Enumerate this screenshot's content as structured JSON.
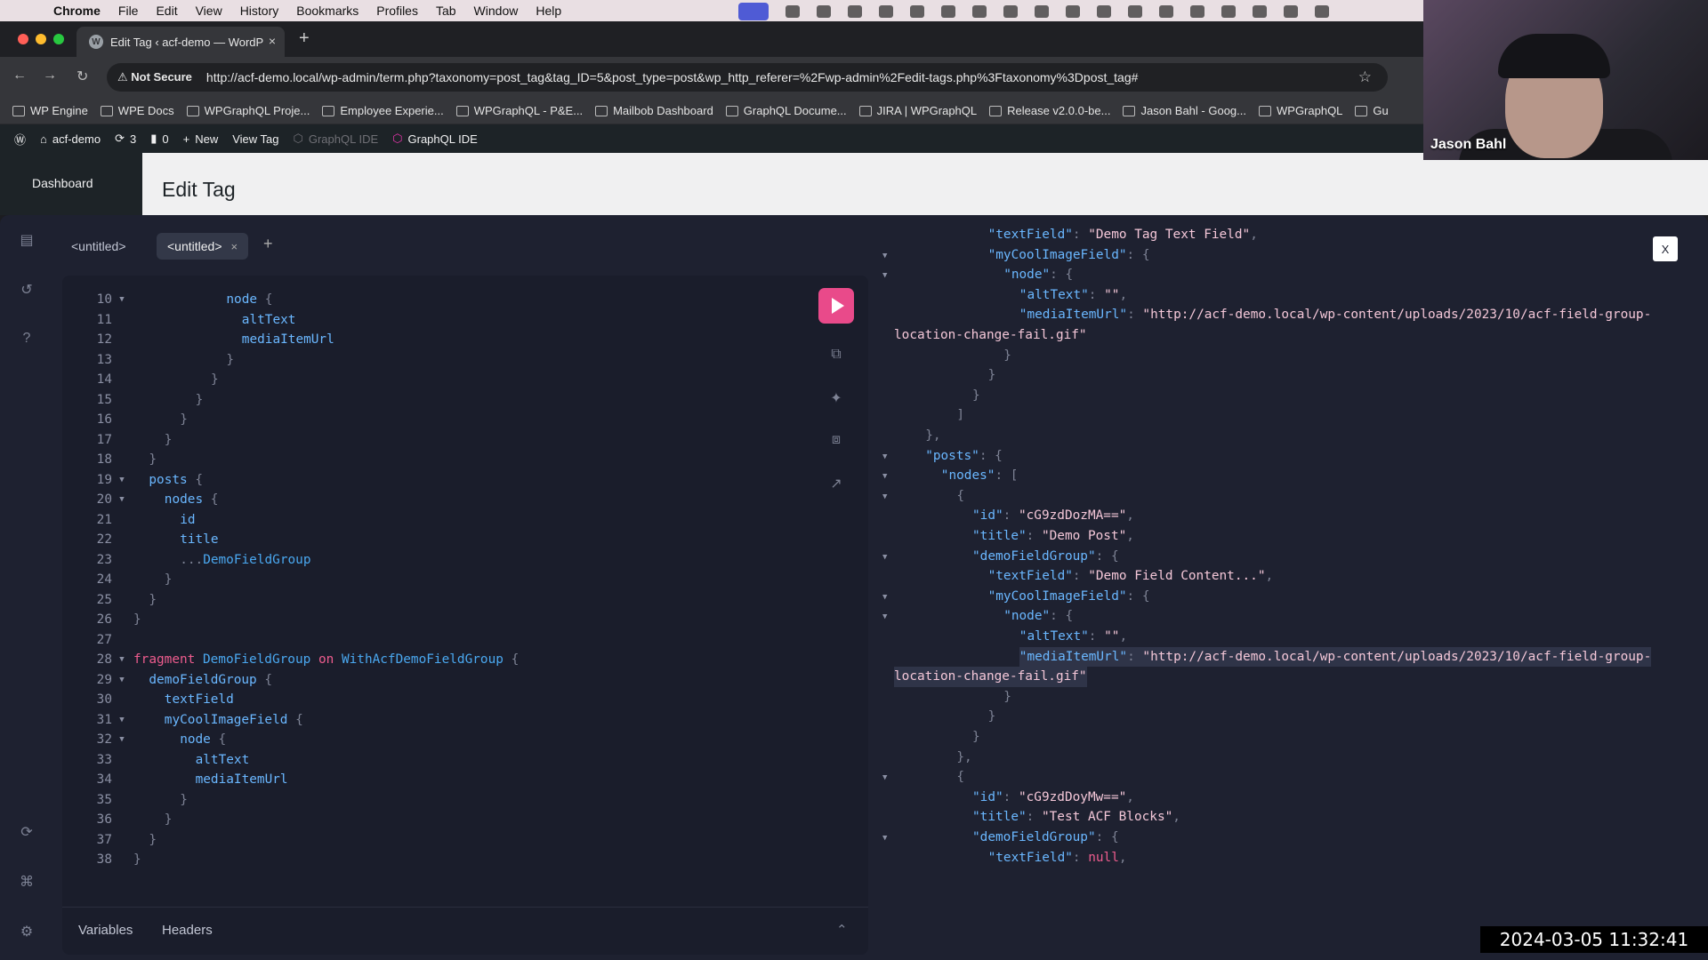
{
  "menubar": {
    "items": [
      "Chrome",
      "File",
      "Edit",
      "View",
      "History",
      "Bookmarks",
      "Profiles",
      "Tab",
      "Window",
      "Help"
    ]
  },
  "browser": {
    "tab_title": "Edit Tag ‹ acf-demo — WordP",
    "security": "Not Secure",
    "url": "http://acf-demo.local/wp-admin/term.php?taxonomy=post_tag&tag_ID=5&post_type=post&wp_http_referer=%2Fwp-admin%2Fedit-tags.php%3Ftaxonomy%3Dpost_tag#"
  },
  "bookmarks": [
    "WP Engine",
    "WPE Docs",
    "WPGraphQL Proje...",
    "Employee Experie...",
    "WPGraphQL - P&E...",
    "Mailbob Dashboard",
    "GraphQL Docume...",
    "JIRA | WPGraphQL",
    "Release v2.0.0-be...",
    "Jason Bahl - Goog...",
    "WPGraphQL",
    "Gu"
  ],
  "wp_adminbar": {
    "site": "acf-demo",
    "updates": "3",
    "comments": "0",
    "new": "New",
    "view_tag": "View Tag",
    "graphql_ide_dim": "GraphQL IDE",
    "graphql_ide": "GraphQL IDE"
  },
  "wp": {
    "sidebar_item": "Dashboard",
    "page_title": "Edit Tag"
  },
  "ide": {
    "tabs": [
      "<untitled>",
      "<untitled>"
    ],
    "close_label": "X",
    "bottom_tabs": {
      "variables": "Variables",
      "headers": "Headers"
    }
  },
  "query_lines": [
    {
      "n": "10",
      "f": true,
      "i": 6,
      "t": [
        [
          "fd",
          "node"
        ],
        [
          "pu",
          " {"
        ]
      ]
    },
    {
      "n": "11",
      "f": false,
      "i": 7,
      "t": [
        [
          "fd",
          "altText"
        ]
      ]
    },
    {
      "n": "12",
      "f": false,
      "i": 7,
      "t": [
        [
          "fd",
          "mediaItemUrl"
        ]
      ]
    },
    {
      "n": "13",
      "f": false,
      "i": 6,
      "t": [
        [
          "pu",
          "}"
        ]
      ]
    },
    {
      "n": "14",
      "f": false,
      "i": 5,
      "t": [
        [
          "pu",
          "}"
        ]
      ]
    },
    {
      "n": "15",
      "f": false,
      "i": 4,
      "t": [
        [
          "pu",
          "}"
        ]
      ]
    },
    {
      "n": "16",
      "f": false,
      "i": 3,
      "t": [
        [
          "pu",
          "}"
        ]
      ]
    },
    {
      "n": "17",
      "f": false,
      "i": 2,
      "t": [
        [
          "pu",
          "}"
        ]
      ]
    },
    {
      "n": "18",
      "f": false,
      "i": 1,
      "t": [
        [
          "pu",
          "}"
        ]
      ]
    },
    {
      "n": "19",
      "f": true,
      "i": 1,
      "t": [
        [
          "fd",
          "posts"
        ],
        [
          "pu",
          " {"
        ]
      ]
    },
    {
      "n": "20",
      "f": true,
      "i": 2,
      "t": [
        [
          "fd",
          "nodes"
        ],
        [
          "pu",
          " {"
        ]
      ]
    },
    {
      "n": "21",
      "f": false,
      "i": 3,
      "t": [
        [
          "fd",
          "id"
        ]
      ]
    },
    {
      "n": "22",
      "f": false,
      "i": 3,
      "t": [
        [
          "fd",
          "title"
        ]
      ]
    },
    {
      "n": "23",
      "f": false,
      "i": 3,
      "t": [
        [
          "pu",
          "..."
        ],
        [
          "fr",
          "DemoFieldGroup"
        ]
      ]
    },
    {
      "n": "24",
      "f": false,
      "i": 2,
      "t": [
        [
          "pu",
          "}"
        ]
      ]
    },
    {
      "n": "25",
      "f": false,
      "i": 1,
      "t": [
        [
          "pu",
          "}"
        ]
      ]
    },
    {
      "n": "26",
      "f": false,
      "i": 0,
      "t": [
        [
          "pu",
          "}"
        ]
      ]
    },
    {
      "n": "27",
      "f": false,
      "i": 0,
      "t": []
    },
    {
      "n": "28",
      "f": true,
      "i": 0,
      "t": [
        [
          "kw",
          "fragment "
        ],
        [
          "fr",
          "DemoFieldGroup "
        ],
        [
          "kw",
          "on "
        ],
        [
          "fr",
          "WithAcfDemoFieldGroup"
        ],
        [
          "pu",
          " {"
        ]
      ]
    },
    {
      "n": "29",
      "f": true,
      "i": 1,
      "t": [
        [
          "fd",
          "demoFieldGroup"
        ],
        [
          "pu",
          " {"
        ]
      ]
    },
    {
      "n": "30",
      "f": false,
      "i": 2,
      "t": [
        [
          "fd",
          "textField"
        ]
      ]
    },
    {
      "n": "31",
      "f": true,
      "i": 2,
      "t": [
        [
          "fd",
          "myCoolImageField"
        ],
        [
          "pu",
          " {"
        ]
      ]
    },
    {
      "n": "32",
      "f": true,
      "i": 3,
      "t": [
        [
          "fd",
          "node"
        ],
        [
          "pu",
          " {"
        ]
      ]
    },
    {
      "n": "33",
      "f": false,
      "i": 4,
      "t": [
        [
          "fd",
          "altText"
        ]
      ]
    },
    {
      "n": "34",
      "f": false,
      "i": 4,
      "t": [
        [
          "fd",
          "mediaItemUrl"
        ]
      ]
    },
    {
      "n": "35",
      "f": false,
      "i": 3,
      "t": [
        [
          "pu",
          "}"
        ]
      ]
    },
    {
      "n": "36",
      "f": false,
      "i": 2,
      "t": [
        [
          "pu",
          "}"
        ]
      ]
    },
    {
      "n": "37",
      "f": false,
      "i": 1,
      "t": [
        [
          "pu",
          "}"
        ]
      ]
    },
    {
      "n": "38",
      "f": false,
      "i": 0,
      "t": [
        [
          "pu",
          "}"
        ]
      ]
    }
  ],
  "result_lines": [
    {
      "f": false,
      "i": 6,
      "t": [
        [
          "rk",
          "\"textField\""
        ],
        [
          "pu",
          ": "
        ],
        [
          "rs",
          "\"Demo Tag Text Field\""
        ],
        [
          "pu",
          ","
        ]
      ]
    },
    {
      "f": true,
      "i": 6,
      "t": [
        [
          "rk",
          "\"myCoolImageField\""
        ],
        [
          "pu",
          ": {"
        ]
      ]
    },
    {
      "f": true,
      "i": 7,
      "t": [
        [
          "rk",
          "\"node\""
        ],
        [
          "pu",
          ": {"
        ]
      ]
    },
    {
      "f": false,
      "i": 8,
      "t": [
        [
          "rk",
          "\"altText\""
        ],
        [
          "pu",
          ": "
        ],
        [
          "rs",
          "\"\""
        ],
        [
          "pu",
          ","
        ]
      ]
    },
    {
      "f": false,
      "i": 8,
      "t": [
        [
          "rk",
          "\"mediaItemUrl\""
        ],
        [
          "pu",
          ": "
        ],
        [
          "rs",
          "\"http://acf-demo.local/wp-content/uploads/2023/10/acf-field-group-"
        ]
      ]
    },
    {
      "f": false,
      "i": 0,
      "t": [
        [
          "rs",
          "location-change-fail.gif\""
        ]
      ]
    },
    {
      "f": false,
      "i": 7,
      "t": [
        [
          "pu",
          "}"
        ]
      ]
    },
    {
      "f": false,
      "i": 6,
      "t": [
        [
          "pu",
          "}"
        ]
      ]
    },
    {
      "f": false,
      "i": 5,
      "t": [
        [
          "pu",
          "}"
        ]
      ]
    },
    {
      "f": false,
      "i": 4,
      "t": [
        [
          "pu",
          "]"
        ]
      ]
    },
    {
      "f": false,
      "i": 2,
      "t": [
        [
          "pu",
          "},"
        ]
      ]
    },
    {
      "f": true,
      "i": 2,
      "t": [
        [
          "rk",
          "\"posts\""
        ],
        [
          "pu",
          ": {"
        ]
      ]
    },
    {
      "f": true,
      "i": 3,
      "t": [
        [
          "rk",
          "\"nodes\""
        ],
        [
          "pu",
          ": ["
        ]
      ]
    },
    {
      "f": true,
      "i": 4,
      "t": [
        [
          "pu",
          "{"
        ]
      ]
    },
    {
      "f": false,
      "i": 5,
      "t": [
        [
          "rk",
          "\"id\""
        ],
        [
          "pu",
          ": "
        ],
        [
          "rs",
          "\"cG9zdDozMA==\""
        ],
        [
          "pu",
          ","
        ]
      ]
    },
    {
      "f": false,
      "i": 5,
      "t": [
        [
          "rk",
          "\"title\""
        ],
        [
          "pu",
          ": "
        ],
        [
          "rs",
          "\"Demo Post\""
        ],
        [
          "pu",
          ","
        ]
      ]
    },
    {
      "f": true,
      "i": 5,
      "t": [
        [
          "rk",
          "\"demoFieldGroup\""
        ],
        [
          "pu",
          ": {"
        ]
      ]
    },
    {
      "f": false,
      "i": 6,
      "t": [
        [
          "rk",
          "\"textField\""
        ],
        [
          "pu",
          ": "
        ],
        [
          "rs",
          "\"Demo Field Content...\""
        ],
        [
          "pu",
          ","
        ]
      ]
    },
    {
      "f": true,
      "i": 6,
      "t": [
        [
          "rk",
          "\"myCoolImageField\""
        ],
        [
          "pu",
          ": {"
        ]
      ]
    },
    {
      "f": true,
      "i": 7,
      "t": [
        [
          "rk",
          "\"node\""
        ],
        [
          "pu",
          ": {"
        ]
      ]
    },
    {
      "f": false,
      "i": 8,
      "t": [
        [
          "rk",
          "\"altText\""
        ],
        [
          "pu",
          ": "
        ],
        [
          "rs",
          "\"\""
        ],
        [
          "pu",
          ","
        ]
      ]
    },
    {
      "f": false,
      "i": 8,
      "h": true,
      "t": [
        [
          "rk",
          "\"mediaItemUrl\""
        ],
        [
          "pu",
          ": "
        ],
        [
          "rs",
          "\"http://acf-demo.local/wp-content/uploads/2023/10/acf-field-group-"
        ]
      ]
    },
    {
      "f": false,
      "i": 0,
      "h": true,
      "t": [
        [
          "rs",
          "location-change-fail.gif\""
        ]
      ]
    },
    {
      "f": false,
      "i": 7,
      "t": [
        [
          "pu",
          "}"
        ]
      ]
    },
    {
      "f": false,
      "i": 6,
      "t": [
        [
          "pu",
          "}"
        ]
      ]
    },
    {
      "f": false,
      "i": 5,
      "t": [
        [
          "pu",
          "}"
        ]
      ]
    },
    {
      "f": false,
      "i": 4,
      "t": [
        [
          "pu",
          "},"
        ]
      ]
    },
    {
      "f": true,
      "i": 4,
      "t": [
        [
          "pu",
          "{"
        ]
      ]
    },
    {
      "f": false,
      "i": 5,
      "t": [
        [
          "rk",
          "\"id\""
        ],
        [
          "pu",
          ": "
        ],
        [
          "rs",
          "\"cG9zdDoyMw==\""
        ],
        [
          "pu",
          ","
        ]
      ]
    },
    {
      "f": false,
      "i": 5,
      "t": [
        [
          "rk",
          "\"title\""
        ],
        [
          "pu",
          ": "
        ],
        [
          "rs",
          "\"Test ACF Blocks\""
        ],
        [
          "pu",
          ","
        ]
      ]
    },
    {
      "f": true,
      "i": 5,
      "t": [
        [
          "rk",
          "\"demoFieldGroup\""
        ],
        [
          "pu",
          ": {"
        ]
      ]
    },
    {
      "f": false,
      "i": 6,
      "t": [
        [
          "rk",
          "\"textField\""
        ],
        [
          "pu",
          ": "
        ],
        [
          "rn",
          "null"
        ],
        [
          "pu",
          ","
        ]
      ]
    }
  ],
  "video": {
    "speaker": "Jason Bahl",
    "timestamp": "2024-03-05 11:32:41"
  }
}
